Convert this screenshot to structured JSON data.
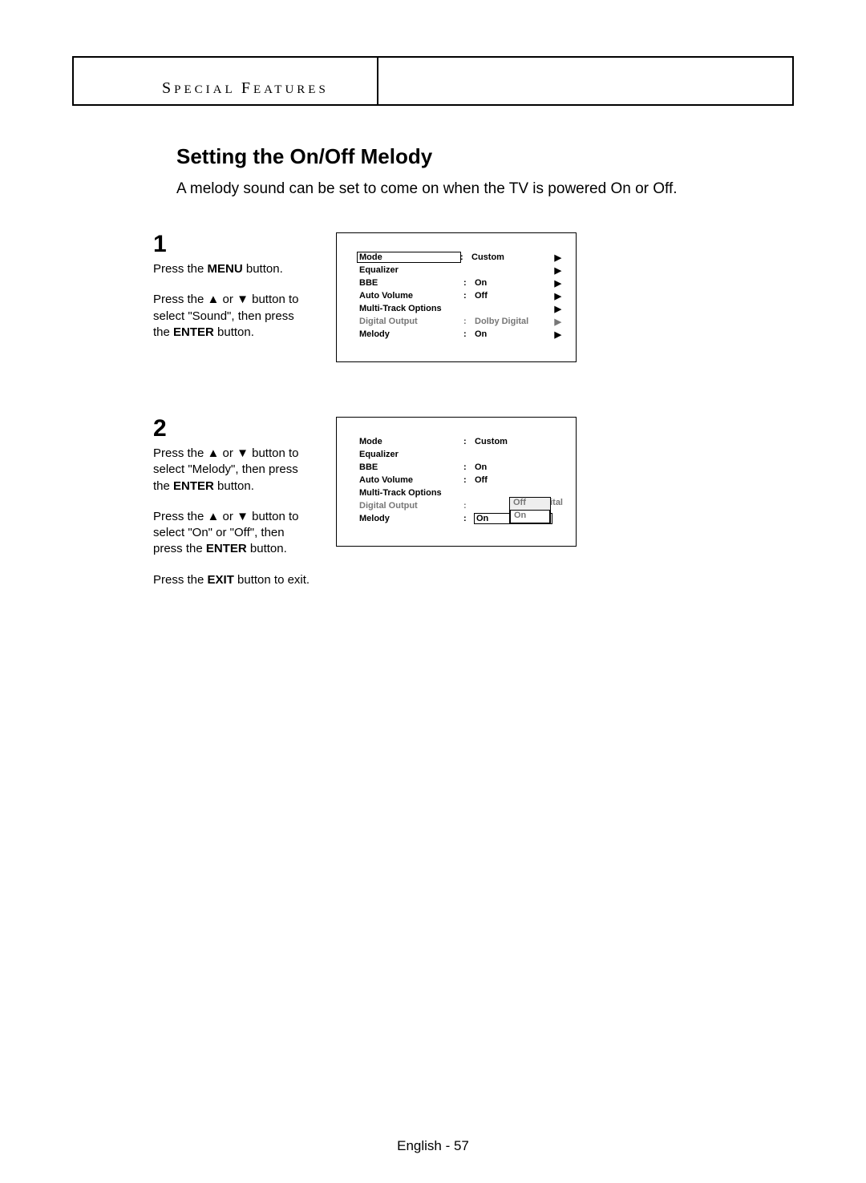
{
  "section_header": {
    "word1_cap": "S",
    "word1_rest": "PECIAL",
    "word2_cap": "F",
    "word2_rest": "EATURES"
  },
  "title": "Setting the On/Off Melody",
  "intro": "A melody sound can be set to come on when the TV is powered On or Off.",
  "steps": {
    "s1": {
      "num": "1",
      "p1_a": "Press the ",
      "p1_b": "MENU",
      "p1_c": " button.",
      "p2_a": "Press the ",
      "p2_up": "▲",
      "p2_mid": " or ",
      "p2_dn": "▼",
      "p2_b": " button to select \"Sound\", then press the ",
      "p2_c": "ENTER",
      "p2_d": " button."
    },
    "s2": {
      "num": "2",
      "p1_a": "Press the ",
      "p1_up": "▲",
      "p1_mid": " or ",
      "p1_dn": "▼",
      "p1_b": " button to select \"Melody\", then press the ",
      "p1_c": "ENTER",
      "p1_d": " button.",
      "p2_a": "Press the ",
      "p2_up": "▲",
      "p2_mid": " or ",
      "p2_dn": "▼",
      "p2_b": " button to select \"On\" or \"Off\", then press the ",
      "p2_c": "ENTER",
      "p2_d": " button.",
      "p3_a": "Press the ",
      "p3_b": "EXIT",
      "p3_c": " button to exit."
    }
  },
  "osd1": {
    "rows": [
      {
        "label": "Mode",
        "val": "Custom",
        "tri": "▶",
        "hl_label": true
      },
      {
        "label": "Equalizer",
        "val": "",
        "tri": "▶"
      },
      {
        "label": "BBE",
        "val": "On",
        "tri": "▶"
      },
      {
        "label": "Auto Volume",
        "val": "Off",
        "tri": "▶"
      },
      {
        "label": "Multi-Track Options",
        "val": "",
        "tri": "▶"
      },
      {
        "label": "Digital Output",
        "val": "Dolby Digital",
        "tri": "▶",
        "dim": true
      },
      {
        "label": "Melody",
        "val": "On",
        "tri": "▶"
      }
    ]
  },
  "osd2": {
    "rows": [
      {
        "label": "Mode",
        "val": "Custom"
      },
      {
        "label": "Equalizer",
        "val": ""
      },
      {
        "label": "BBE",
        "val": "On"
      },
      {
        "label": "Auto Volume",
        "val": "Off"
      },
      {
        "label": "Multi-Track Options",
        "val": ""
      },
      {
        "label": "Digital Output",
        "val": "",
        "dim": true
      },
      {
        "label": "Melody",
        "val": "On",
        "hl_val": true
      }
    ],
    "popup": {
      "opt1": "Off",
      "opt2": "On",
      "tail": "ital"
    }
  },
  "footer": "English - 57"
}
